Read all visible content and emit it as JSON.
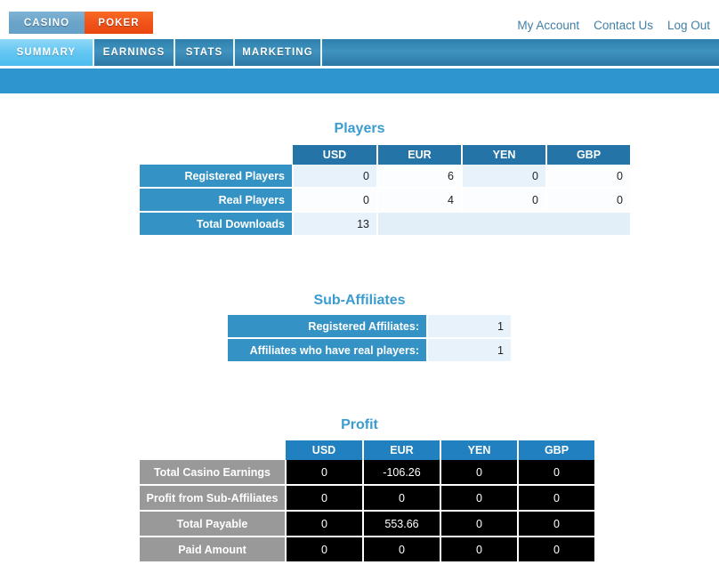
{
  "product_tabs": [
    {
      "label": "CASINO",
      "active": false
    },
    {
      "label": "POKER",
      "active": true
    }
  ],
  "account_links": [
    {
      "label": "My Account"
    },
    {
      "label": "Contact Us"
    },
    {
      "label": "Log Out"
    }
  ],
  "section_tabs": [
    {
      "label": "SUMMARY",
      "active": true
    },
    {
      "label": "EARNINGS",
      "active": false
    },
    {
      "label": "STATS",
      "active": false
    },
    {
      "label": "MARKETING",
      "active": false
    }
  ],
  "players": {
    "title": "Players",
    "columns": [
      "USD",
      "EUR",
      "YEN",
      "GBP"
    ],
    "rows": [
      {
        "label": "Registered Players",
        "values": [
          "0",
          "6",
          "0",
          "0"
        ]
      },
      {
        "label": "Real Players",
        "values": [
          "0",
          "4",
          "0",
          "0"
        ]
      },
      {
        "label": "Total Downloads",
        "values": [
          "13"
        ]
      }
    ]
  },
  "sub_affiliates": {
    "title": "Sub-Affiliates",
    "rows": [
      {
        "label": "Registered Affiliates:",
        "value": "1"
      },
      {
        "label": "Affiliates who have real players:",
        "value": "1"
      }
    ]
  },
  "profit": {
    "title": "Profit",
    "columns": [
      "USD",
      "EUR",
      "YEN",
      "GBP"
    ],
    "rows": [
      {
        "label": "Total Casino Earnings",
        "values": [
          "0",
          "-106.26",
          "0",
          "0"
        ]
      },
      {
        "label": "Profit from Sub-Affiliates",
        "values": [
          "0",
          "0",
          "0",
          "0"
        ]
      },
      {
        "label": "Total Payable",
        "values": [
          "0",
          "553.66",
          "0",
          "0"
        ]
      },
      {
        "label": "Paid Amount",
        "values": [
          "0",
          "0",
          "0",
          "0"
        ]
      }
    ]
  },
  "colors": {
    "accent_blue": "#2f95ce",
    "poker_orange": "#f0521a",
    "heading_blue": "#3b9cd0",
    "table_header_blue": "#2474a8",
    "row_header_blue": "#3492c4",
    "profit_row_header_gray": "#999999",
    "profit_cell_black": "#000000"
  }
}
